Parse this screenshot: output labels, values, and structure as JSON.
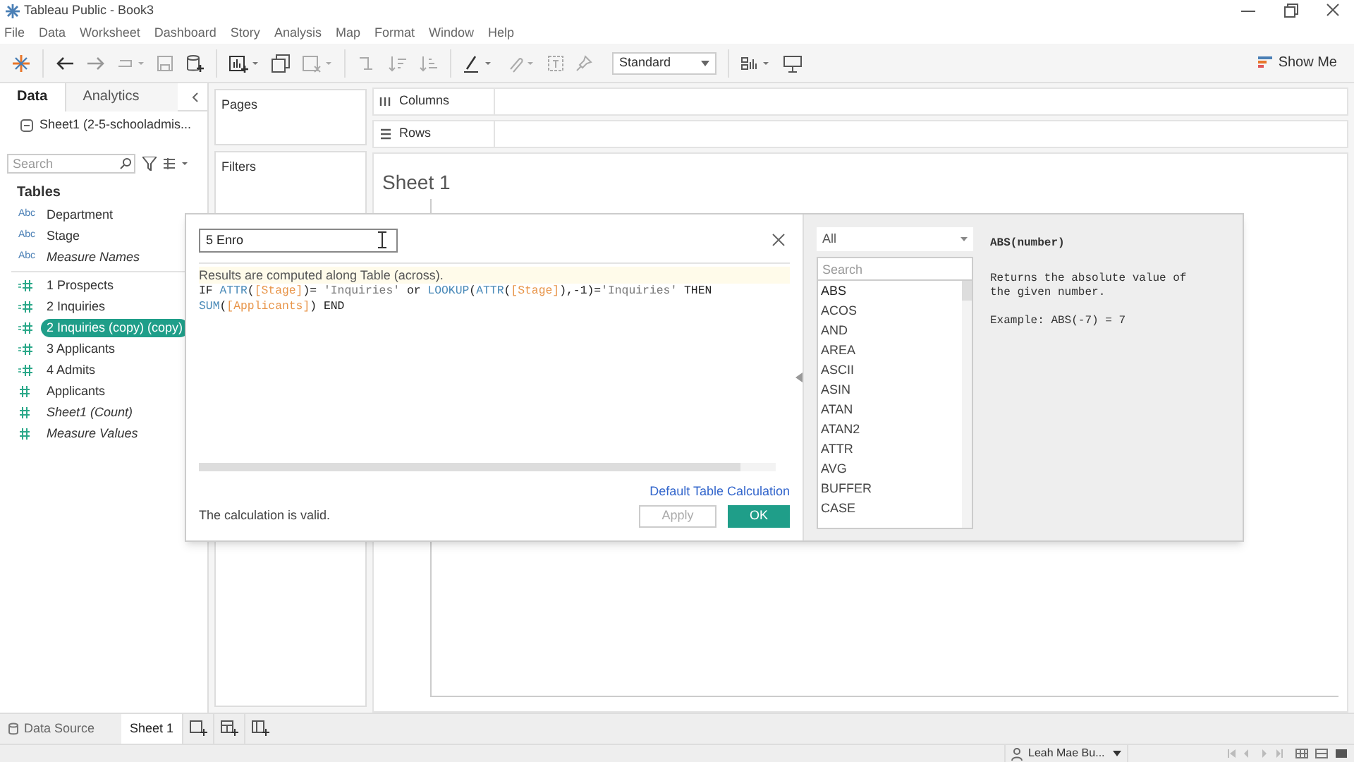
{
  "window": {
    "title": "Tableau Public - Book3"
  },
  "menu": [
    "File",
    "Data",
    "Worksheet",
    "Dashboard",
    "Story",
    "Analysis",
    "Map",
    "Format",
    "Window",
    "Help"
  ],
  "toolbar": {
    "fit_dropdown": "Standard",
    "show_me": "Show Me"
  },
  "data_pane": {
    "tabs": [
      {
        "label": "Data",
        "selected": true
      },
      {
        "label": "Analytics",
        "selected": false
      }
    ],
    "data_source": "Sheet1 (2-5-schooladmis...",
    "search": {
      "placeholder": "Search"
    },
    "section": "Tables",
    "fields": [
      {
        "kind": "dimension",
        "type_label": "Abc",
        "name": "Department",
        "italic": false,
        "selected": false
      },
      {
        "kind": "dimension",
        "type_label": "Abc",
        "name": "Stage",
        "italic": false,
        "selected": false
      },
      {
        "kind": "dimension",
        "type_label": "Abc",
        "name": "Measure Names",
        "italic": true,
        "selected": false
      },
      {
        "kind": "calc_measure",
        "name": "1 Prospects",
        "italic": false,
        "selected": false
      },
      {
        "kind": "calc_measure",
        "name": "2 Inquiries",
        "italic": false,
        "selected": false
      },
      {
        "kind": "calc_measure",
        "name": "2 Inquiries (copy) (copy)",
        "italic": false,
        "selected": true
      },
      {
        "kind": "calc_measure",
        "name": "3 Applicants",
        "italic": false,
        "selected": false
      },
      {
        "kind": "calc_measure",
        "name": "4 Admits",
        "italic": false,
        "selected": false
      },
      {
        "kind": "measure",
        "name": "Applicants",
        "italic": false,
        "selected": false
      },
      {
        "kind": "measure",
        "name": "Sheet1 (Count)",
        "italic": true,
        "selected": false
      },
      {
        "kind": "measure",
        "name": "Measure Values",
        "italic": true,
        "selected": false
      }
    ]
  },
  "cards": {
    "pages": "Pages",
    "filters": "Filters"
  },
  "shelves": {
    "columns": "Columns",
    "rows": "Rows"
  },
  "sheet": {
    "title": "Sheet 1"
  },
  "calc_dialog": {
    "name_value": "5 Enro",
    "info": "Results are computed along Table (across).",
    "formula_lines": [
      [
        {
          "kind": "keyword",
          "text": "IF "
        },
        {
          "kind": "function",
          "text": "ATTR"
        },
        {
          "kind": "plain",
          "text": "("
        },
        {
          "kind": "field",
          "text": "[Stage]"
        },
        {
          "kind": "plain",
          "text": ")= "
        },
        {
          "kind": "string",
          "text": "'Inquiries'"
        },
        {
          "kind": "keyword",
          "text": " or "
        },
        {
          "kind": "function",
          "text": "LOOKUP"
        },
        {
          "kind": "plain",
          "text": "("
        },
        {
          "kind": "function",
          "text": "ATTR"
        },
        {
          "kind": "plain",
          "text": "("
        },
        {
          "kind": "field",
          "text": "[Stage]"
        },
        {
          "kind": "plain",
          "text": "),-1)="
        },
        {
          "kind": "string",
          "text": "'Inquiries'"
        },
        {
          "kind": "keyword",
          "text": " THEN"
        }
      ],
      [
        {
          "kind": "function",
          "text": "SUM"
        },
        {
          "kind": "plain",
          "text": "("
        },
        {
          "kind": "field",
          "text": "[Applicants]"
        },
        {
          "kind": "plain",
          "text": ") "
        },
        {
          "kind": "keyword",
          "text": "END"
        }
      ]
    ],
    "link": "Default Table Calculation",
    "status": "The calculation is valid.",
    "apply": {
      "label": "Apply",
      "disabled": true
    },
    "ok": "OK",
    "function_category": "All",
    "function_search": {
      "placeholder": "Search"
    },
    "functions": [
      {
        "name": "ABS",
        "selected": true
      },
      {
        "name": "ACOS",
        "selected": false
      },
      {
        "name": "AND",
        "selected": false
      },
      {
        "name": "AREA",
        "selected": false
      },
      {
        "name": "ASCII",
        "selected": false
      },
      {
        "name": "ASIN",
        "selected": false
      },
      {
        "name": "ATAN",
        "selected": false
      },
      {
        "name": "ATAN2",
        "selected": false
      },
      {
        "name": "ATTR",
        "selected": false
      },
      {
        "name": "AVG",
        "selected": false
      },
      {
        "name": "BUFFER",
        "selected": false
      },
      {
        "name": "CASE",
        "selected": false
      }
    ],
    "help": {
      "signature": "ABS(number)",
      "description": "Returns the absolute value of the given number.",
      "example": "Example: ABS(-7) = 7"
    }
  },
  "bottom_tabs": [
    {
      "kind": "data_source",
      "label": "Data Source",
      "selected": false
    },
    {
      "kind": "sheet",
      "label": "Sheet 1",
      "selected": true
    }
  ],
  "status_bar": {
    "user": "Leah Mae Bu..."
  }
}
